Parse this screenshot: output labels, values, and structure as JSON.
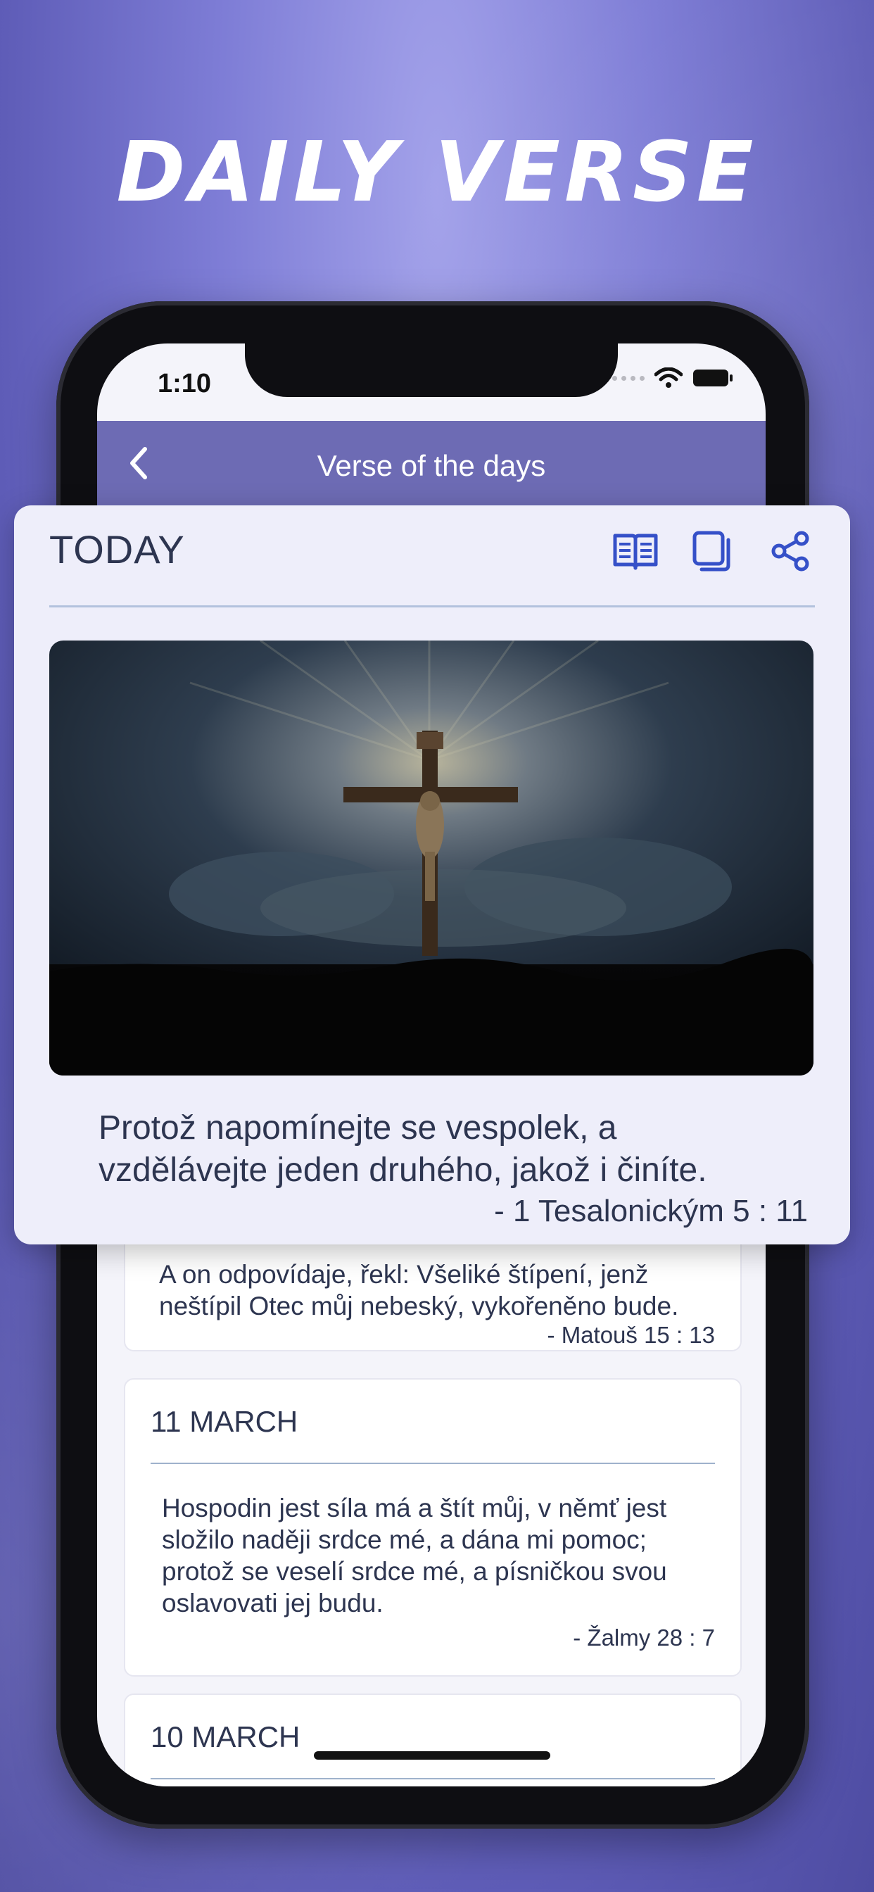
{
  "hero": {
    "title": "DAILY VERSE"
  },
  "status_bar": {
    "time": "1:10"
  },
  "navbar": {
    "title": "Verse of the days",
    "back_icon": "chevron-left-icon"
  },
  "today": {
    "label": "TODAY",
    "actions": [
      {
        "name": "read-icon",
        "label": "read"
      },
      {
        "name": "copy-icon",
        "label": "copy"
      },
      {
        "name": "share-icon",
        "label": "share"
      }
    ],
    "image": "crucifix-image",
    "verse": "Protož napomínejte se vespolek, a vzdělávejte jeden druhého, jakož i činíte.",
    "reference": "-  1 Tesalonickým 5 : 11"
  },
  "list": [
    {
      "date": "",
      "verse": "A on odpovídaje, řekl: Všeliké štípení, jenž neštípil Otec můj nebeský, vykořeněno bude.",
      "reference": "-  Matouš 15 : 13"
    },
    {
      "date": "11 MARCH",
      "verse": "Hospodin jest síla má a štít můj, v němť jest složilo naději srdce mé, a dána mi pomoc; protož se veselí srdce mé, a písničkou svou oslavovati jej budu.",
      "reference": "-  Žalmy 28 : 7"
    },
    {
      "date": "10 MARCH",
      "verse": "",
      "reference": ""
    }
  ],
  "colors": {
    "accent": "#6d6bb4",
    "text": "#2d3550",
    "icon": "#3550c8"
  }
}
